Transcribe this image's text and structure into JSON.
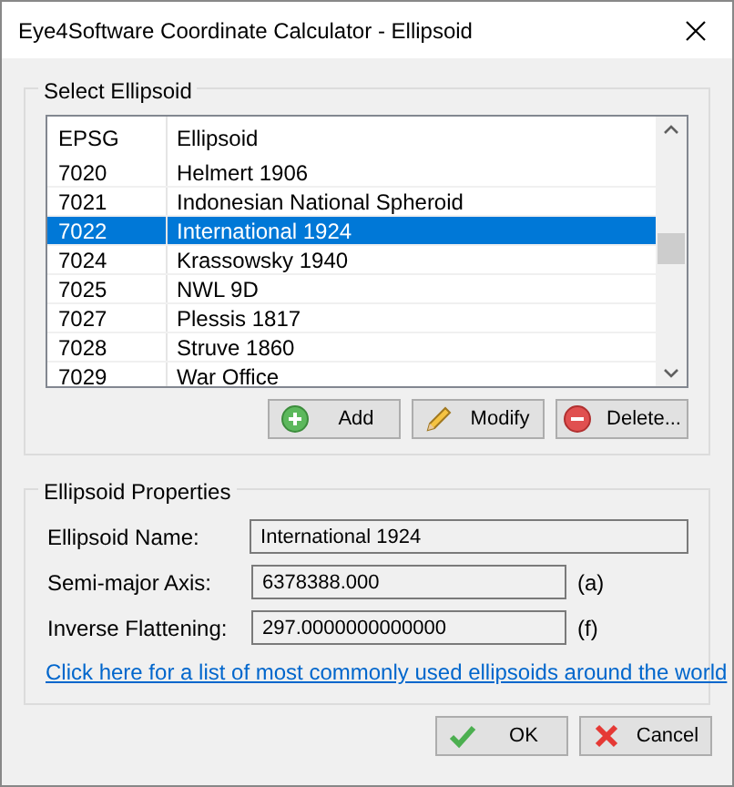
{
  "window": {
    "title": "Eye4Software Coordinate Calculator - Ellipsoid"
  },
  "select_group": {
    "title": "Select Ellipsoid",
    "columns": [
      "EPSG",
      "Ellipsoid"
    ],
    "rows": [
      {
        "epsg": "7020",
        "ellipsoid": "Helmert 1906",
        "selected": false
      },
      {
        "epsg": "7021",
        "ellipsoid": "Indonesian National Spheroid",
        "selected": false
      },
      {
        "epsg": "7022",
        "ellipsoid": "International 1924",
        "selected": true
      },
      {
        "epsg": "7024",
        "ellipsoid": "Krassowsky 1940",
        "selected": false
      },
      {
        "epsg": "7025",
        "ellipsoid": "NWL 9D",
        "selected": false
      },
      {
        "epsg": "7027",
        "ellipsoid": "Plessis 1817",
        "selected": false
      },
      {
        "epsg": "7028",
        "ellipsoid": "Struve 1860",
        "selected": false
      },
      {
        "epsg": "7029",
        "ellipsoid": "War Office",
        "selected": false
      }
    ],
    "buttons": [
      {
        "kind": "add",
        "label": "Add"
      },
      {
        "kind": "modify",
        "label": "Modify"
      },
      {
        "kind": "delete",
        "label": "Delete..."
      }
    ]
  },
  "properties_group": {
    "title": "Ellipsoid Properties",
    "fields": [
      {
        "label": "Ellipsoid Name:",
        "value": "International 1924"
      },
      {
        "label": "Semi-major Axis:",
        "value": "6378388.000",
        "unit": "(a)"
      },
      {
        "label": "Inverse Flattening:",
        "value": "297.0000000000000",
        "unit": "(f)"
      }
    ],
    "link": "Click here for a list of most commonly used ellipsoids around the world"
  },
  "buttons": [
    {
      "kind": "ok",
      "label": "OK"
    },
    {
      "kind": "cancel",
      "label": "Cancel"
    }
  ]
}
